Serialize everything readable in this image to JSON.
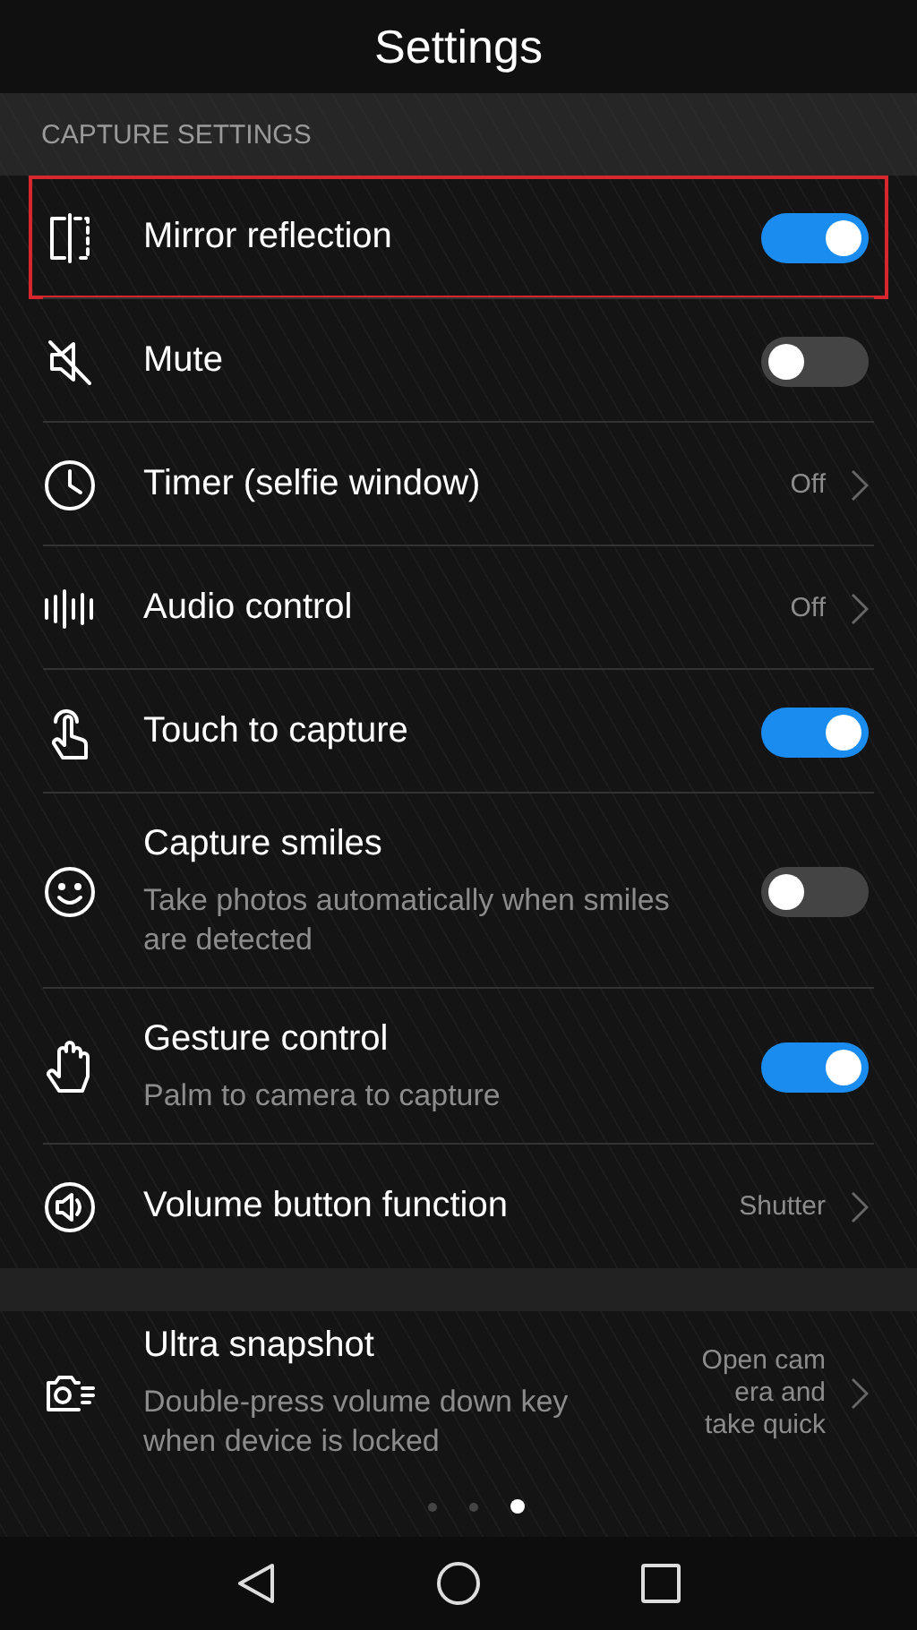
{
  "title": "Settings",
  "section": "CAPTURE SETTINGS",
  "items": [
    {
      "kind": "toggle",
      "label": "Mirror reflection",
      "on": true,
      "highlighted": true
    },
    {
      "kind": "toggle",
      "label": "Mute",
      "on": false,
      "highlighted": false
    },
    {
      "kind": "value",
      "label": "Timer (selfie window)",
      "value": "Off",
      "highlighted": false
    },
    {
      "kind": "value",
      "label": "Audio control",
      "value": "Off",
      "highlighted": false
    },
    {
      "kind": "toggle",
      "label": "Touch to capture",
      "on": true,
      "highlighted": false
    },
    {
      "kind": "toggle",
      "label": "Capture smiles",
      "description": "Take photos automatically when smiles are detected",
      "on": false,
      "highlighted": false
    },
    {
      "kind": "toggle",
      "label": "Gesture control",
      "description": "Palm to camera to capture",
      "on": true,
      "highlighted": false
    },
    {
      "kind": "value",
      "label": "Volume button function",
      "value": "Shutter",
      "highlighted": false
    },
    {
      "kind": "value",
      "label": "Ultra snapshot",
      "description": "Double-press volume down key when device is locked",
      "value": "Open cam\nera and\ntake quick",
      "highlighted": false
    }
  ],
  "pages": [
    {
      "selected": false
    },
    {
      "selected": false
    },
    {
      "selected": true
    }
  ]
}
